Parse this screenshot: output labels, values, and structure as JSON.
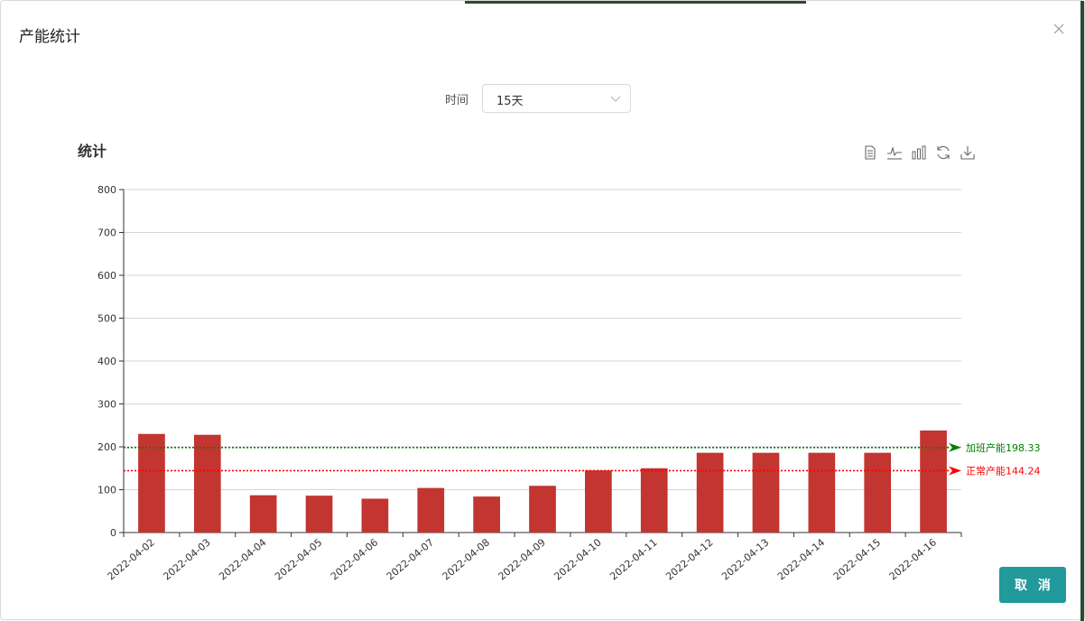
{
  "dialog": {
    "title": "产能统计",
    "cancel_label": "取 消"
  },
  "filter": {
    "label": "时间",
    "selected": "15天"
  },
  "chart_data": {
    "type": "bar",
    "title": "统计",
    "categories": [
      "2022-04-02",
      "2022-04-03",
      "2022-04-04",
      "2022-04-05",
      "2022-04-06",
      "2022-04-07",
      "2022-04-08",
      "2022-04-09",
      "2022-04-10",
      "2022-04-11",
      "2022-04-12",
      "2022-04-13",
      "2022-04-14",
      "2022-04-15",
      "2022-04-16"
    ],
    "values": [
      230,
      228,
      87,
      86,
      79,
      104,
      84,
      109,
      145,
      150,
      186,
      186,
      186,
      186,
      238
    ],
    "ylim": [
      0,
      800
    ],
    "yticks": [
      0,
      100,
      200,
      300,
      400,
      500,
      600,
      700,
      800
    ],
    "xlabel": "",
    "ylabel": "",
    "grid": true,
    "bar_color": "#c23531",
    "mark_lines": [
      {
        "label": "加班产能198.33",
        "value": 198.33,
        "color": "#008000"
      },
      {
        "label": "正常产能144.24",
        "value": 144.24,
        "color": "#ff0000"
      }
    ]
  },
  "toolbox": [
    "data-view-icon",
    "line-chart-icon",
    "bar-chart-icon",
    "refresh-icon",
    "download-icon"
  ],
  "colors": {
    "accent": "#22999a"
  }
}
